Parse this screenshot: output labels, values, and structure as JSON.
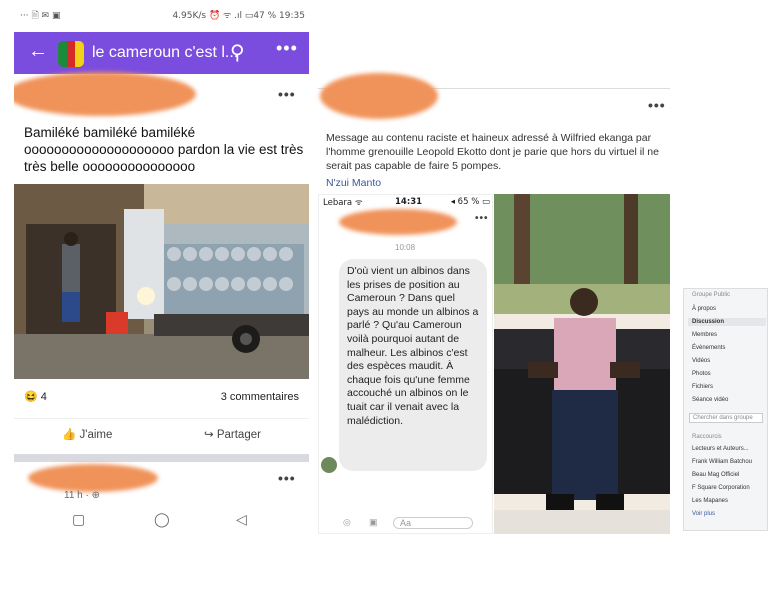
{
  "left_phone": {
    "status_left": "··· 🗎 ✉ ▣",
    "status_right": "4.95K/s ⏰ ᯤ .ıl ▭47 % 19:35",
    "group_title": "le cameroun c'est l...",
    "post_text": "Bamiléké bamiléké bamiléké oooooooooooooooooooo pardon la vie est très très belle ooooooooooooooo",
    "reaction_count": "4",
    "comments_label": "3 commentaires",
    "like_label": "J'aime",
    "share_label": "Partager",
    "second_post_time": "11 h · ⊕",
    "flag_colors": [
      "#1b8a3a",
      "#d62a28",
      "#f3d118"
    ]
  },
  "middle": {
    "post_message": "Message au contenu raciste et haineux adressé à Wilfried ekanga par l'homme grenouille Leopold Ekotto dont je parie que hors du virtuel il ne serait pas capable de faire 5 pompes.",
    "post_link": "N'zui Manto",
    "chat_status_left": "Lebara ᯤ",
    "chat_status_time": "14:31",
    "chat_status_right": "◂ 65 % ▭",
    "chat_time": "10:08",
    "chat_message": "D'où vient un albinos dans les prises de position au Cameroun ? Dans quel pays au monde un albinos a parlé ? Qu'au Cameroun voilà pourquoi autant de malheur. Les albinos c'est des espèces maudit. À chaque fois qu'une femme accouché un albinos on le tuait car il venait avec la malédiction.",
    "chat_input_placeholder": "Aa"
  },
  "right_panel": {
    "header": "Groupe Public",
    "items": [
      "À propos",
      "Discussion",
      "Membres",
      "Évènements",
      "Vidéos",
      "Photos",
      "Fichiers",
      "Séance vidéo"
    ],
    "search_placeholder": "Chercher dans groupe",
    "recent_header": "Raccourcis",
    "shortcuts": [
      "Lecteurs et Auteurs...",
      "Frank William Batchou",
      "Beau Mag Officiel",
      "F Square Corporation",
      "Les Mapanes",
      "Voir plus"
    ]
  }
}
